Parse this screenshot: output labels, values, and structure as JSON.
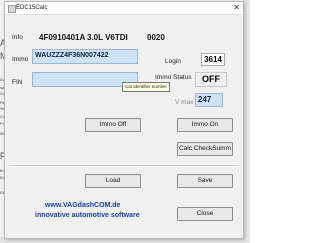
{
  "window": {
    "title": "EDC15Calc",
    "close_glyph": "✕"
  },
  "info": {
    "label": "Info",
    "ecu_part": "4F0910401A",
    "engine": "3.0L V6TDI",
    "code": "0020"
  },
  "immo": {
    "label": "Immo",
    "value": "WAUZZZ4F36N007422",
    "tooltip": "Car identifier number"
  },
  "login": {
    "label": "Login",
    "value": "3614"
  },
  "fin": {
    "label": "FIN",
    "value": ""
  },
  "immo_status": {
    "label": "Immo Status",
    "value": "OFF"
  },
  "vmax": {
    "label": "V max",
    "value": "247"
  },
  "buttons": {
    "immo_off": "Immo Off",
    "immo_on": "Immo On",
    "calc_checksum": "Calc CheckSumm",
    "load": "Load",
    "save": "Save",
    "close": "Close"
  },
  "footer": {
    "site": "www.VAGdashCOM.de",
    "slogan": "innovative automotive software"
  },
  "background": {
    "items": [
      "Ar",
      "Me",
      "Dat",
      "sav",
      "Calc",
      "Rete",
      "Sta",
      "Cur",
      "Prea",
      "Wart",
      "Po",
      "Equ",
      "Equ",
      "Elipt"
    ]
  }
}
